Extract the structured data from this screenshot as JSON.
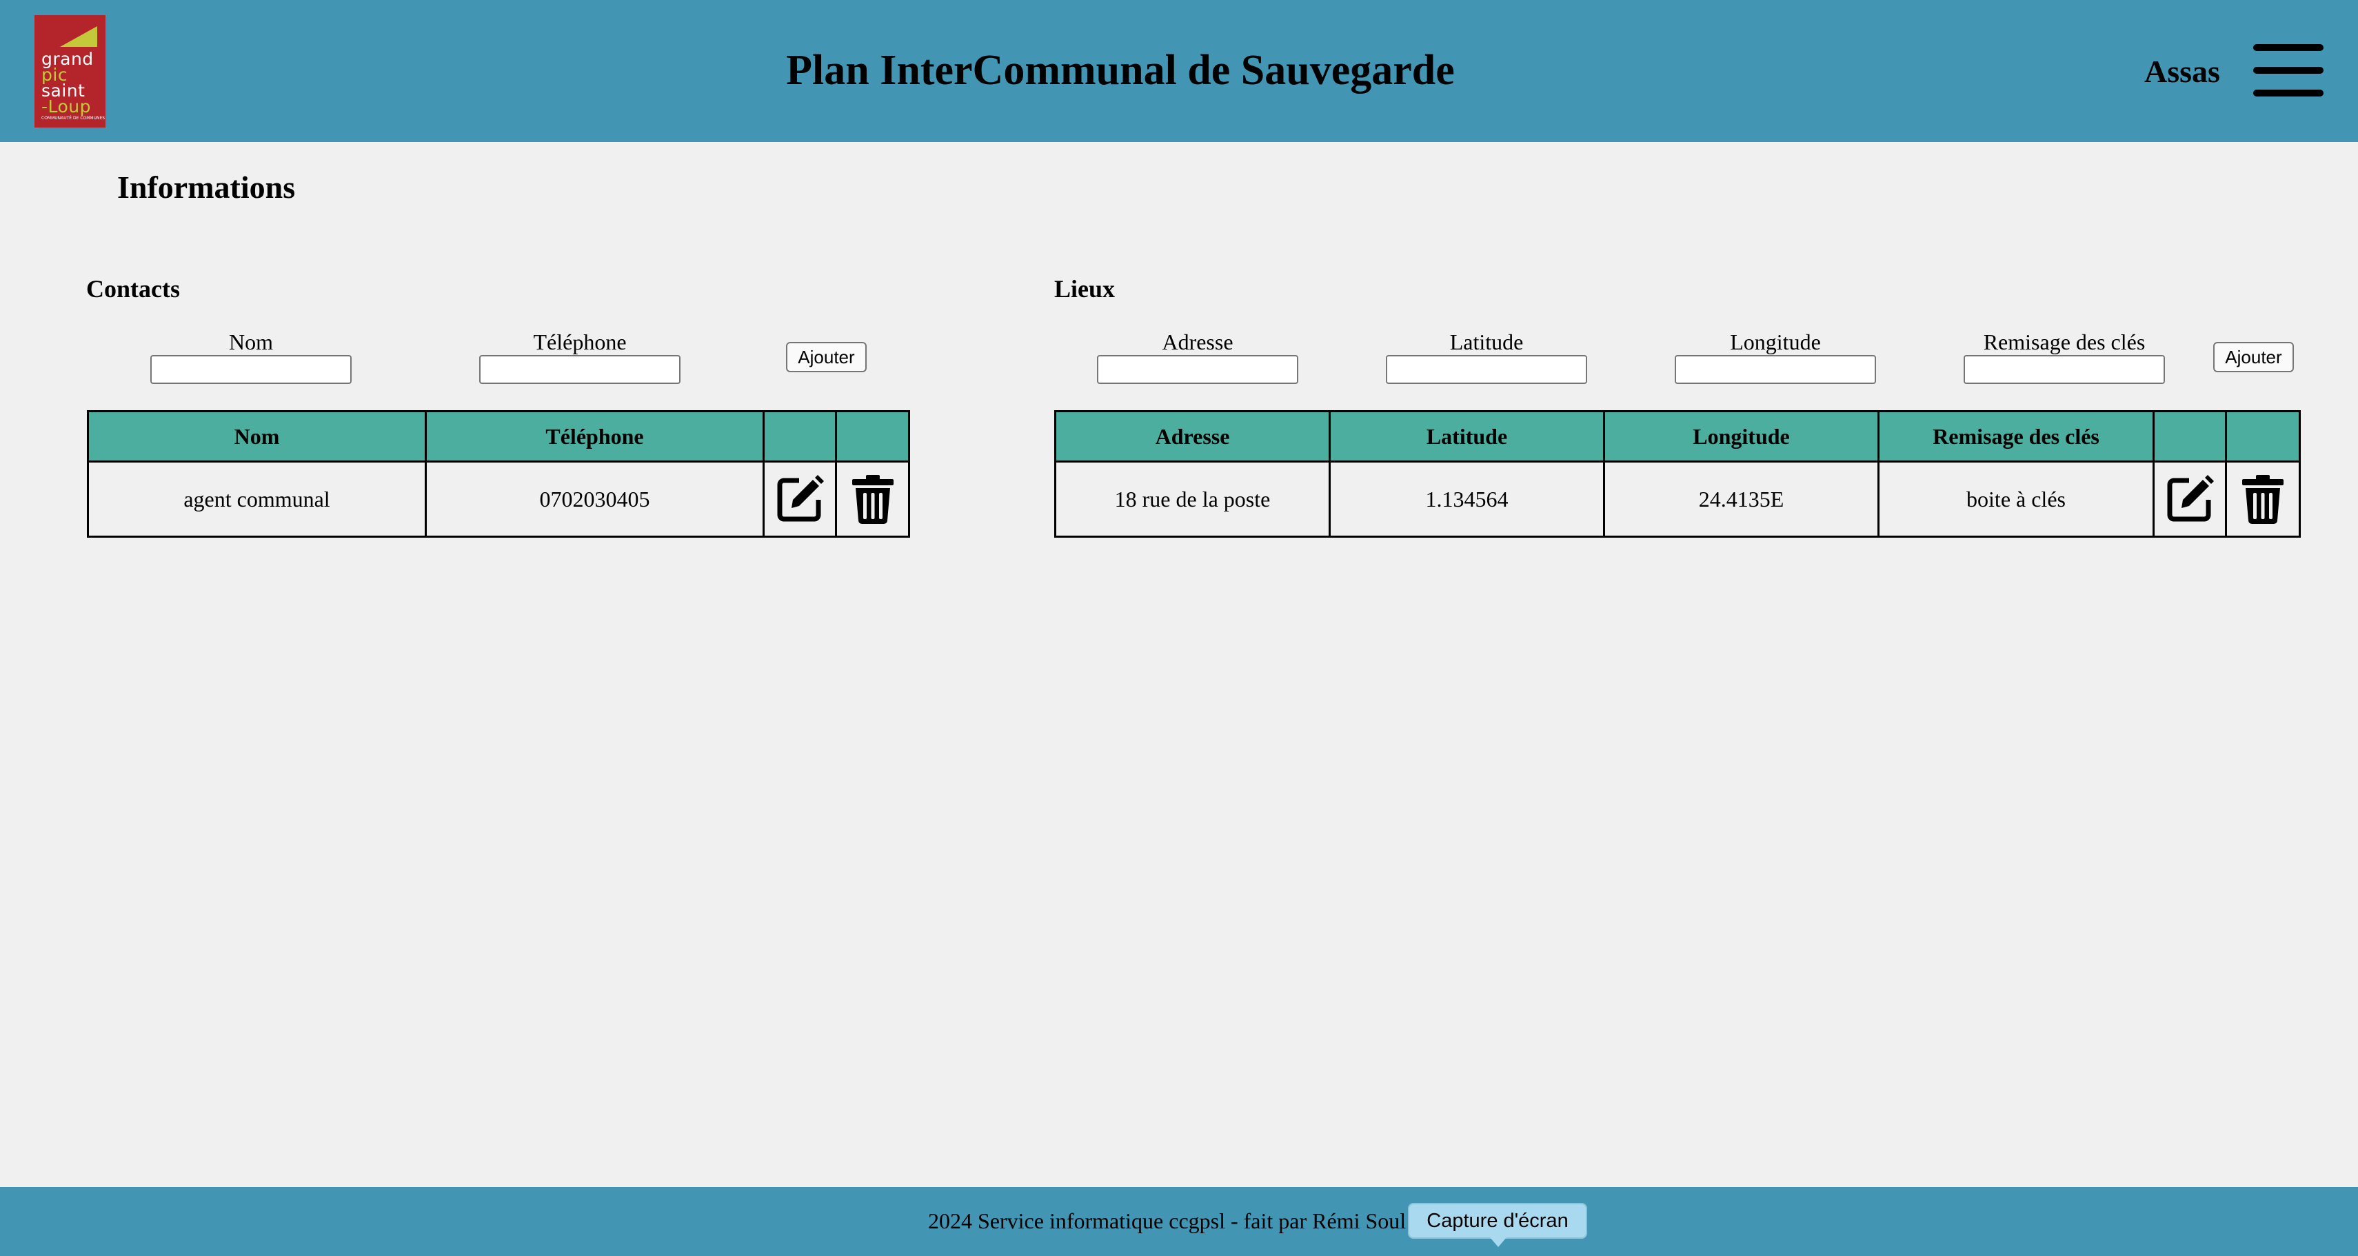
{
  "header": {
    "logo": {
      "line1": "grand",
      "line2": "pic",
      "line3": "saint",
      "line4": "-Loup",
      "tagline": "COMMUNAUTÉ DE COMMUNES"
    },
    "title": "Plan InterCommunal de Sauvegarde",
    "user": "Assas",
    "menu_icon": "hamburger-menu-icon"
  },
  "page": {
    "title": "Informations"
  },
  "contacts": {
    "title": "Contacts",
    "form": {
      "nom_label": "Nom",
      "nom_value": "",
      "telephone_label": "Téléphone",
      "telephone_value": "",
      "add_label": "Ajouter"
    },
    "table": {
      "headers": [
        "Nom",
        "Téléphone",
        "",
        ""
      ],
      "rows": [
        {
          "nom": "agent communal",
          "telephone": "0702030405",
          "edit_icon": "edit-icon",
          "delete_icon": "trash-icon"
        }
      ]
    }
  },
  "lieux": {
    "title": "Lieux",
    "form": {
      "adresse_label": "Adresse",
      "adresse_value": "",
      "latitude_label": "Latitude",
      "latitude_value": "",
      "longitude_label": "Longitude",
      "longitude_value": "",
      "remisage_label": "Remisage des clés",
      "remisage_value": "",
      "add_label": "Ajouter"
    },
    "table": {
      "headers": [
        "Adresse",
        "Latitude",
        "Longitude",
        "Remisage des clés",
        "",
        ""
      ],
      "rows": [
        {
          "adresse": "18 rue de la poste",
          "latitude": "1.134564",
          "longitude": "24.4135E",
          "remisage": "boite à clés",
          "edit_icon": "edit-icon",
          "delete_icon": "trash-icon"
        }
      ]
    }
  },
  "footer": {
    "text": "2024 Service informatique ccgpsl - fait par Rémi Soul"
  },
  "tooltip": {
    "text": "Capture d'écran"
  },
  "colors": {
    "header_bg": "#4296b4",
    "table_header_bg": "#4cae9f",
    "page_bg": "#f0f0f0",
    "logo_bg": "#b3252b",
    "logo_accent": "#c4c93a",
    "tooltip_bg": "#a9d9ef"
  }
}
